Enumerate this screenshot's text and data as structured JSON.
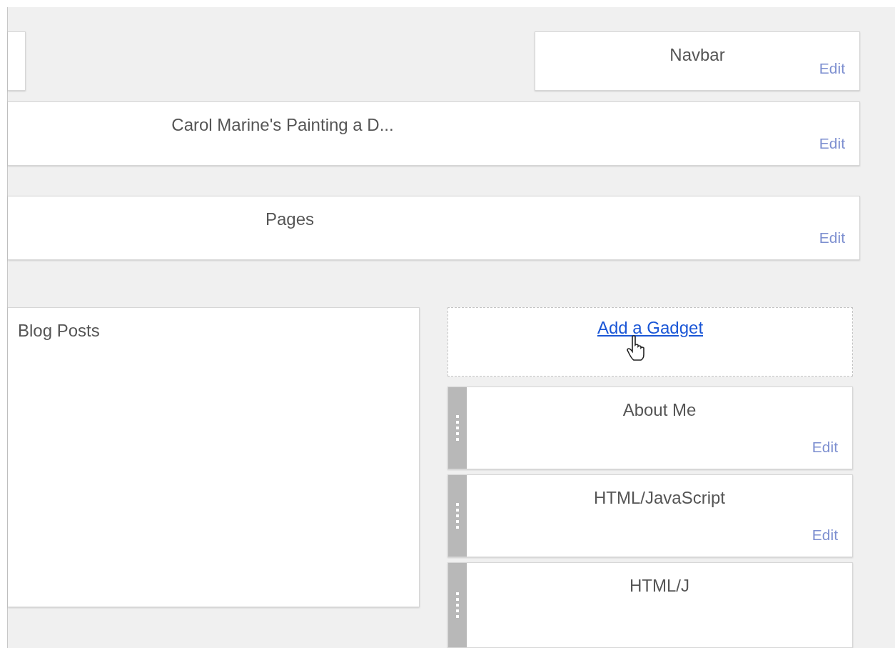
{
  "navbar": {
    "title": "Navbar",
    "edit": "Edit"
  },
  "header": {
    "title": "Carol Marine's Painting a D...",
    "edit": "Edit"
  },
  "pages": {
    "title": "Pages",
    "edit": "Edit"
  },
  "main": {
    "title": "Blog Posts"
  },
  "sidebar": {
    "add_gadget": "Add a Gadget",
    "gadgets": [
      {
        "title": "About Me",
        "edit": "Edit"
      },
      {
        "title": "HTML/JavaScript",
        "edit": "Edit"
      },
      {
        "title": "HTML/J"
      }
    ]
  }
}
